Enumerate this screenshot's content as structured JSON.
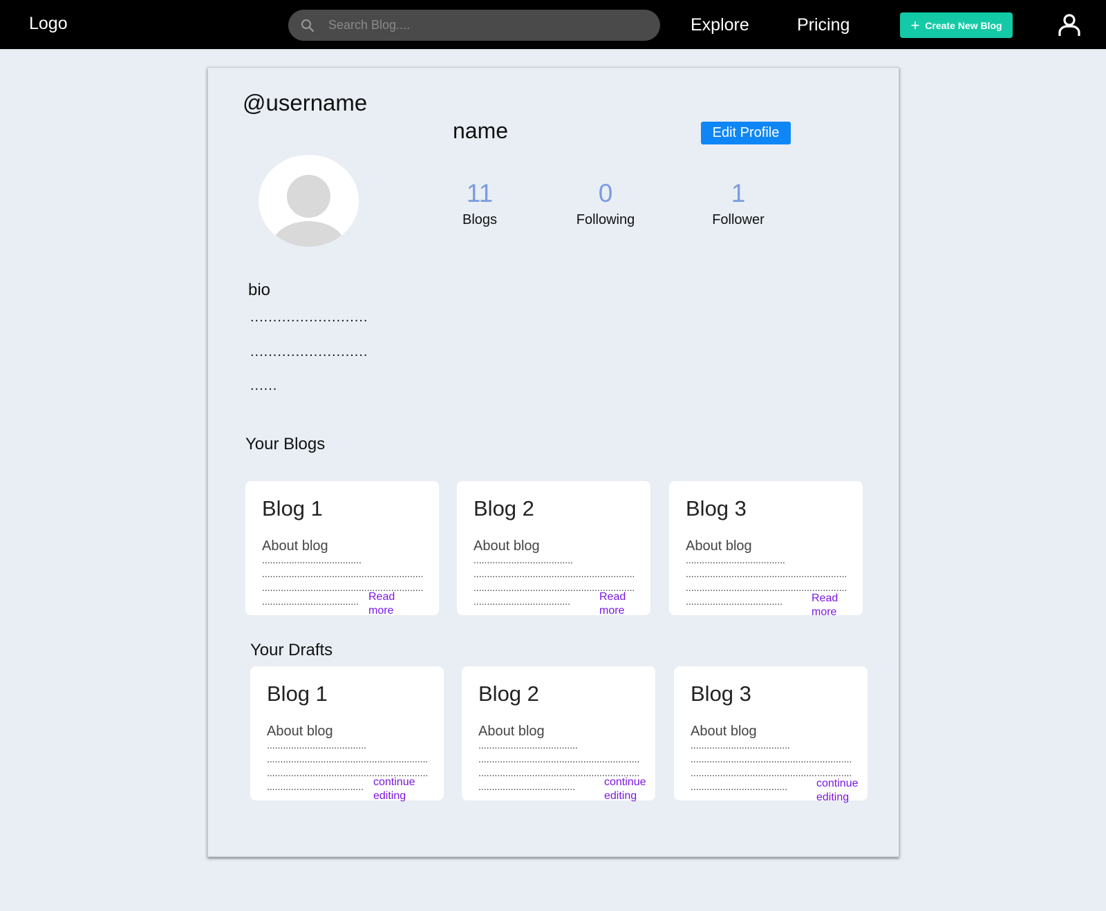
{
  "navbar": {
    "logo": "Logo",
    "search_placeholder": "Search Blog....",
    "links": [
      "Explore",
      "Pricing"
    ],
    "create_button": "Create New Blog"
  },
  "profile": {
    "username": "@username",
    "name": "name",
    "edit_button": "Edit Profile",
    "stats": [
      {
        "value": "11",
        "label": "Blogs"
      },
      {
        "value": "0",
        "label": "Following"
      },
      {
        "value": "1",
        "label": "Follower"
      }
    ],
    "bio_label": "bio",
    "bio_lines": [
      "..........................",
      "..........................",
      "......"
    ]
  },
  "your_blogs": {
    "title": "Your Blogs",
    "items": [
      {
        "title": "Blog 1",
        "about": "About blog",
        "link": "Read more"
      },
      {
        "title": "Blog 2",
        "about": "About blog",
        "link": "Read more"
      },
      {
        "title": "Blog 3",
        "about": "About blog",
        "link": "Read more"
      }
    ]
  },
  "your_drafts": {
    "title": "Your Drafts",
    "items": [
      {
        "title": "Blog 1",
        "about": "About blog",
        "link": "continue editing"
      },
      {
        "title": "Blog 2",
        "about": "About blog",
        "link": "continue editing"
      },
      {
        "title": "Blog 3",
        "about": "About blog",
        "link": "continue editing"
      }
    ]
  },
  "colors": {
    "navbar_bg": "#000000",
    "page_bg": "#e8eef4",
    "create_button": "#14c9a6",
    "edit_button": "#0f86f5",
    "stat_number": "#7b9be0",
    "tile_link": "#7a16e0"
  }
}
